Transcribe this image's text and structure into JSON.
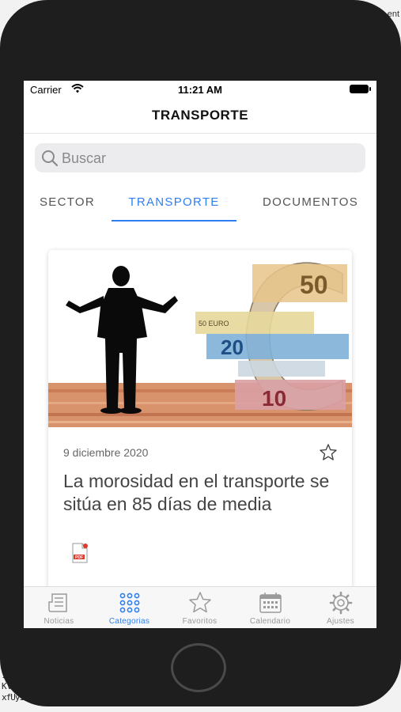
{
  "status_bar": {
    "carrier": "Carrier",
    "time": "11:21 AM"
  },
  "nav": {
    "title": "TRANSPORTE"
  },
  "search": {
    "placeholder": "Buscar"
  },
  "tabs": [
    {
      "label": "SECTOR",
      "active": false
    },
    {
      "label": "TRANSPORTE",
      "active": true
    },
    {
      "label": "DOCUMENTOS",
      "active": false
    }
  ],
  "article": {
    "date": "9 diciembre 2020",
    "title": "La morosidad en el transporte se sitúa en 85 días de media",
    "image_text": {
      "top_note": "50",
      "mid_note": "20",
      "bottom_note": "10",
      "small_note": "50 EURO"
    },
    "pdf_label": "PDF",
    "favorite": false
  },
  "tab_bar": [
    {
      "label": "Noticias",
      "icon": "newspaper-icon",
      "active": false
    },
    {
      "label": "Categorias",
      "icon": "grid-icon",
      "active": true
    },
    {
      "label": "Favoritos",
      "icon": "star-icon",
      "active": false
    },
    {
      "label": "Calendario",
      "icon": "calendar-icon",
      "active": false
    },
    {
      "label": "Ajustes",
      "icon": "gear-icon",
      "active": false
    }
  ],
  "background_text": {
    "top_right": "ent",
    "line1": "1",
    "line2": "KV",
    "line3": "xfUyI"
  },
  "colors": {
    "accent": "#2f7ff0",
    "phone_bezel": "#1e1e1e",
    "inactive": "#9a9a9a"
  }
}
